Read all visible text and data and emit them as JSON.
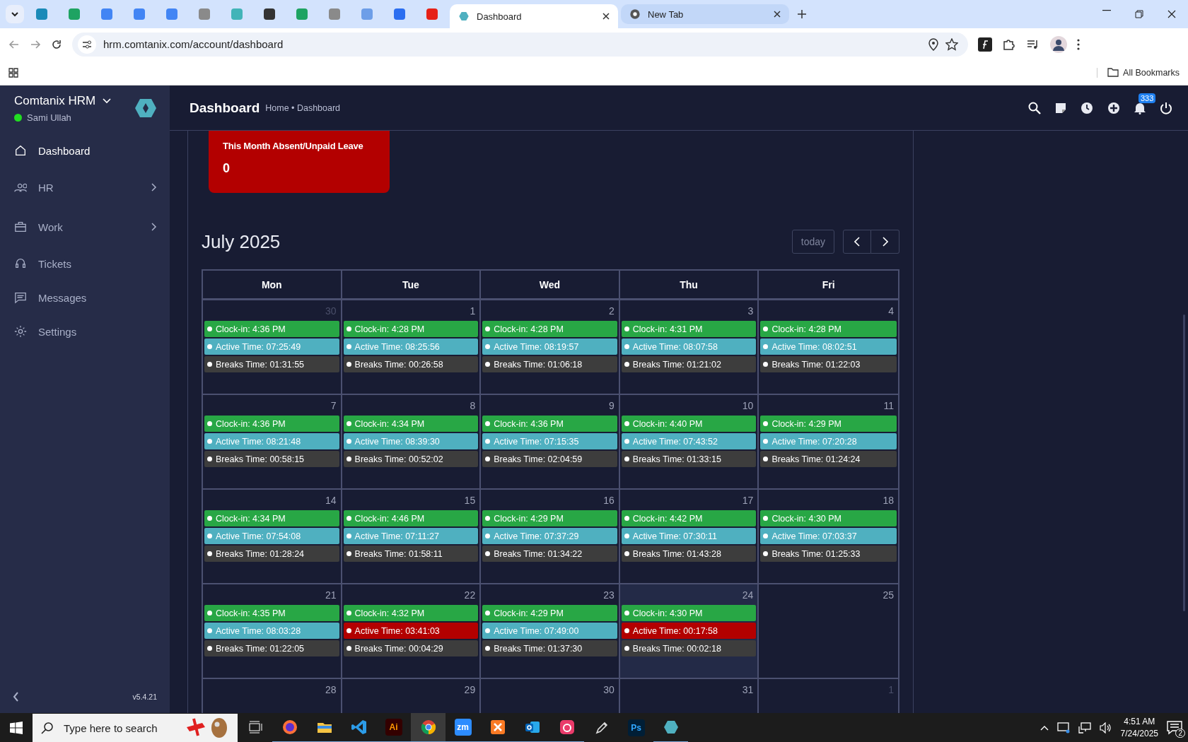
{
  "browser": {
    "pinned_tabs": [
      {
        "selected": false
      },
      {
        "selected": false
      },
      {
        "selected": false
      },
      {
        "selected": false
      },
      {
        "selected": false
      },
      {
        "selected": false
      },
      {
        "selected": false
      },
      {
        "selected": false
      },
      {
        "selected": false
      },
      {
        "selected": false
      },
      {
        "selected": false
      },
      {
        "selected": false
      },
      {
        "selected": false
      }
    ],
    "tabs": [
      {
        "title": "Dashboard",
        "selected": true
      },
      {
        "title": "New Tab",
        "selected": false
      }
    ],
    "url": "hrm.comtanix.com/account/dashboard",
    "bookmarks_label": "All Bookmarks"
  },
  "sidebar": {
    "brand": "Comtanix HRM",
    "user": "Sami Ullah",
    "online": true,
    "items": [
      {
        "label": "Dashboard",
        "selected": true,
        "has_submenu": false
      },
      {
        "label": "HR",
        "selected": false,
        "has_submenu": true
      },
      {
        "label": "Work",
        "selected": false,
        "has_submenu": true
      },
      {
        "label": "Tickets",
        "selected": false,
        "has_submenu": false
      },
      {
        "label": "Messages",
        "selected": false,
        "has_submenu": false
      },
      {
        "label": "Settings",
        "selected": false,
        "has_submenu": false
      }
    ],
    "version": "v5.4.21"
  },
  "header": {
    "title": "Dashboard",
    "breadcrumb": "Home • Dashboard",
    "notification_count": "333"
  },
  "stat_card": {
    "title": "This Month Absent/Unpaid Leave",
    "value": "0"
  },
  "calendar": {
    "title": "July 2025",
    "today_button": {
      "label": "today",
      "disabled": true
    },
    "columns": [
      "Mon",
      "Tue",
      "Wed",
      "Thu",
      "Fri"
    ],
    "weeks": [
      {
        "days": [
          {
            "day": "30",
            "other_month": true,
            "today": false,
            "events": [
              {
                "text": "Clock-in: 4:36 PM",
                "color": "#28a745"
              },
              {
                "text": "Active Time: 07:25:49",
                "color": "#4fb0c0"
              },
              {
                "text": "Breaks Time: 01:31:55",
                "color": "#3d3d3d"
              }
            ]
          },
          {
            "day": "1",
            "other_month": false,
            "today": false,
            "events": [
              {
                "text": "Clock-in: 4:28 PM",
                "color": "#28a745"
              },
              {
                "text": "Active Time: 08:25:56",
                "color": "#4fb0c0"
              },
              {
                "text": "Breaks Time: 00:26:58",
                "color": "#3d3d3d"
              }
            ]
          },
          {
            "day": "2",
            "other_month": false,
            "today": false,
            "events": [
              {
                "text": "Clock-in: 4:28 PM",
                "color": "#28a745"
              },
              {
                "text": "Active Time: 08:19:57",
                "color": "#4fb0c0"
              },
              {
                "text": "Breaks Time: 01:06:18",
                "color": "#3d3d3d"
              }
            ]
          },
          {
            "day": "3",
            "other_month": false,
            "today": false,
            "events": [
              {
                "text": "Clock-in: 4:31 PM",
                "color": "#28a745"
              },
              {
                "text": "Active Time: 08:07:58",
                "color": "#4fb0c0"
              },
              {
                "text": "Breaks Time: 01:21:02",
                "color": "#3d3d3d"
              }
            ]
          },
          {
            "day": "4",
            "other_month": false,
            "today": false,
            "events": [
              {
                "text": "Clock-in: 4:28 PM",
                "color": "#28a745"
              },
              {
                "text": "Active Time: 08:02:51",
                "color": "#4fb0c0"
              },
              {
                "text": "Breaks Time: 01:22:03",
                "color": "#3d3d3d"
              }
            ]
          }
        ]
      },
      {
        "days": [
          {
            "day": "7",
            "other_month": false,
            "today": false,
            "events": [
              {
                "text": "Clock-in: 4:36 PM",
                "color": "#28a745"
              },
              {
                "text": "Active Time: 08:21:48",
                "color": "#4fb0c0"
              },
              {
                "text": "Breaks Time: 00:58:15",
                "color": "#3d3d3d"
              }
            ]
          },
          {
            "day": "8",
            "other_month": false,
            "today": false,
            "events": [
              {
                "text": "Clock-in: 4:34 PM",
                "color": "#28a745"
              },
              {
                "text": "Active Time: 08:39:30",
                "color": "#4fb0c0"
              },
              {
                "text": "Breaks Time: 00:52:02",
                "color": "#3d3d3d"
              }
            ]
          },
          {
            "day": "9",
            "other_month": false,
            "today": false,
            "events": [
              {
                "text": "Clock-in: 4:36 PM",
                "color": "#28a745"
              },
              {
                "text": "Active Time: 07:15:35",
                "color": "#4fb0c0"
              },
              {
                "text": "Breaks Time: 02:04:59",
                "color": "#3d3d3d"
              }
            ]
          },
          {
            "day": "10",
            "other_month": false,
            "today": false,
            "events": [
              {
                "text": "Clock-in: 4:40 PM",
                "color": "#28a745"
              },
              {
                "text": "Active Time: 07:43:52",
                "color": "#4fb0c0"
              },
              {
                "text": "Breaks Time: 01:33:15",
                "color": "#3d3d3d"
              }
            ]
          },
          {
            "day": "11",
            "other_month": false,
            "today": false,
            "events": [
              {
                "text": "Clock-in: 4:29 PM",
                "color": "#28a745"
              },
              {
                "text": "Active Time: 07:20:28",
                "color": "#4fb0c0"
              },
              {
                "text": "Breaks Time: 01:24:24",
                "color": "#3d3d3d"
              }
            ]
          }
        ]
      },
      {
        "days": [
          {
            "day": "14",
            "other_month": false,
            "today": false,
            "events": [
              {
                "text": "Clock-in: 4:34 PM",
                "color": "#28a745"
              },
              {
                "text": "Active Time: 07:54:08",
                "color": "#4fb0c0"
              },
              {
                "text": "Breaks Time: 01:28:24",
                "color": "#3d3d3d"
              }
            ]
          },
          {
            "day": "15",
            "other_month": false,
            "today": false,
            "events": [
              {
                "text": "Clock-in: 4:46 PM",
                "color": "#28a745"
              },
              {
                "text": "Active Time: 07:11:27",
                "color": "#4fb0c0"
              },
              {
                "text": "Breaks Time: 01:58:11",
                "color": "#3d3d3d"
              }
            ]
          },
          {
            "day": "16",
            "other_month": false,
            "today": false,
            "events": [
              {
                "text": "Clock-in: 4:29 PM",
                "color": "#28a745"
              },
              {
                "text": "Active Time: 07:37:29",
                "color": "#4fb0c0"
              },
              {
                "text": "Breaks Time: 01:34:22",
                "color": "#3d3d3d"
              }
            ]
          },
          {
            "day": "17",
            "other_month": false,
            "today": false,
            "events": [
              {
                "text": "Clock-in: 4:42 PM",
                "color": "#28a745"
              },
              {
                "text": "Active Time: 07:30:11",
                "color": "#4fb0c0"
              },
              {
                "text": "Breaks Time: 01:43:28",
                "color": "#3d3d3d"
              }
            ]
          },
          {
            "day": "18",
            "other_month": false,
            "today": false,
            "events": [
              {
                "text": "Clock-in: 4:30 PM",
                "color": "#28a745"
              },
              {
                "text": "Active Time: 07:03:37",
                "color": "#4fb0c0"
              },
              {
                "text": "Breaks Time: 01:25:33",
                "color": "#3d3d3d"
              }
            ]
          }
        ]
      },
      {
        "days": [
          {
            "day": "21",
            "other_month": false,
            "today": false,
            "events": [
              {
                "text": "Clock-in: 4:35 PM",
                "color": "#28a745"
              },
              {
                "text": "Active Time: 08:03:28",
                "color": "#4fb0c0"
              },
              {
                "text": "Breaks Time: 01:22:05",
                "color": "#3d3d3d"
              }
            ]
          },
          {
            "day": "22",
            "other_month": false,
            "today": false,
            "events": [
              {
                "text": "Clock-in: 4:32 PM",
                "color": "#28a745"
              },
              {
                "text": "Active Time: 03:41:03",
                "color": "#b30000"
              },
              {
                "text": "Breaks Time: 00:04:29",
                "color": "#3d3d3d"
              }
            ]
          },
          {
            "day": "23",
            "other_month": false,
            "today": false,
            "events": [
              {
                "text": "Clock-in: 4:29 PM",
                "color": "#28a745"
              },
              {
                "text": "Active Time: 07:49:00",
                "color": "#4fb0c0"
              },
              {
                "text": "Breaks Time: 01:37:30",
                "color": "#3d3d3d"
              }
            ]
          },
          {
            "day": "24",
            "other_month": false,
            "today": true,
            "events": [
              {
                "text": "Clock-in: 4:30 PM",
                "color": "#28a745"
              },
              {
                "text": "Active Time: 00:17:58",
                "color": "#b30000"
              },
              {
                "text": "Breaks Time: 00:02:18",
                "color": "#3d3d3d"
              }
            ]
          },
          {
            "day": "25",
            "other_month": false,
            "today": false
          }
        ]
      },
      {
        "days": [
          {
            "day": "28",
            "other_month": false,
            "today": false
          },
          {
            "day": "29",
            "other_month": false,
            "today": false
          },
          {
            "day": "30",
            "other_month": false,
            "today": false
          },
          {
            "day": "31",
            "other_month": false,
            "today": false
          },
          {
            "day": "1",
            "other_month": true,
            "today": false
          }
        ]
      }
    ]
  },
  "taskbar": {
    "search_placeholder": "Type here to search",
    "apps": [
      {
        "kind": "taskview",
        "selected": false,
        "running": false
      },
      {
        "kind": "firefox",
        "selected": false,
        "running": true
      },
      {
        "kind": "files",
        "selected": false,
        "running": true
      },
      {
        "kind": "vscode",
        "selected": false,
        "running": true
      },
      {
        "kind": "glyph",
        "label": "Ai",
        "selected": false,
        "running": true
      },
      {
        "kind": "chrome",
        "selected": true,
        "running": true
      },
      {
        "kind": "glyph",
        "label": "zm",
        "selected": false,
        "running": true
      },
      {
        "kind": "xampp",
        "selected": false,
        "running": true
      },
      {
        "kind": "outlook",
        "selected": false,
        "running": true
      },
      {
        "kind": "cloud",
        "selected": false,
        "running": true
      },
      {
        "kind": "pen",
        "selected": false,
        "running": false
      },
      {
        "kind": "glyph",
        "label": "Ps",
        "selected": false,
        "running": false
      },
      {
        "kind": "hexagon",
        "selected": false,
        "running": true
      }
    ],
    "time": "4:51 AM",
    "date": "7/24/2025",
    "notifications": "2"
  }
}
